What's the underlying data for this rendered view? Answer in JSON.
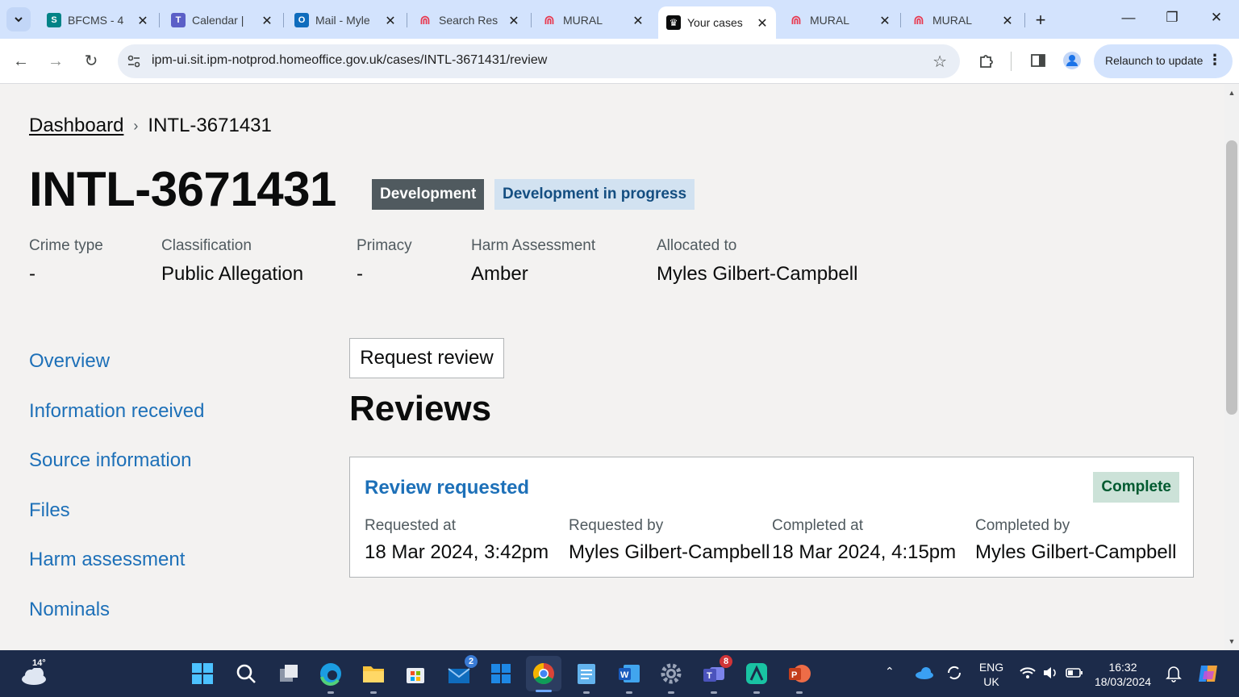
{
  "browser": {
    "tabs": [
      {
        "title": "BFCMS - 4",
        "icon": "sharepoint-icon",
        "color": "#038387",
        "active": false
      },
      {
        "title": "Calendar |",
        "icon": "teams-icon",
        "color": "#5b5fc7",
        "active": false
      },
      {
        "title": "Mail - Myle",
        "icon": "outlook-icon",
        "color": "#0f6cbd",
        "active": false
      },
      {
        "title": "Search Res",
        "icon": "mural-icon",
        "color": "#e8384f",
        "active": false
      },
      {
        "title": "MURAL",
        "icon": "mural-icon",
        "color": "#e8384f",
        "active": false
      },
      {
        "title": "Your cases",
        "icon": "crown-icon",
        "color": "#0b0c0c",
        "active": true
      },
      {
        "title": "MURAL",
        "icon": "mural-icon",
        "color": "#e8384f",
        "active": false
      },
      {
        "title": "MURAL",
        "icon": "mural-icon",
        "color": "#e8384f",
        "active": false
      }
    ],
    "url": "ipm-ui.sit.ipm-notprod.homeoffice.gov.uk/cases/INTL-3671431/review",
    "relaunch_label": "Relaunch to update"
  },
  "breadcrumb": {
    "home": "Dashboard",
    "current": "INTL-3671431"
  },
  "case": {
    "id": "INTL-3671431",
    "phase_tag": "Development",
    "status_tag": "Development in progress"
  },
  "summary": {
    "crime_type_label": "Crime type",
    "crime_type_value": "-",
    "classification_label": "Classification",
    "classification_value": "Public Allegation",
    "primacy_label": "Primacy",
    "primacy_value": "-",
    "harm_label": "Harm Assessment",
    "harm_value": "Amber",
    "allocated_label": "Allocated to",
    "allocated_value": "Myles Gilbert-Campbell"
  },
  "side_nav": [
    "Overview",
    "Information received",
    "Source information",
    "Files",
    "Harm assessment",
    "Nominals"
  ],
  "reviews": {
    "request_button": "Request review",
    "heading": "Reviews",
    "card": {
      "title": "Review requested",
      "status": "Complete",
      "requested_at_label": "Requested at",
      "requested_at_value": "18 Mar 2024, 3:42pm",
      "requested_by_label": "Requested by",
      "requested_by_value": "Myles Gilbert-Campbell",
      "completed_at_label": "Completed at",
      "completed_at_value": "18 Mar 2024, 4:15pm",
      "completed_by_label": "Completed by",
      "completed_by_value": "Myles Gilbert-Campbell"
    }
  },
  "taskbar": {
    "weather_temp": "14°",
    "mail_badge": "2",
    "teams_badge": "8",
    "lang_line1": "ENG",
    "lang_line2": "UK",
    "time": "16:32",
    "date": "18/03/2024"
  },
  "colors": {
    "link": "#1d70b8",
    "tag_grey": "#505a5f",
    "tag_blue_bg": "#d2e2f1",
    "tag_green_bg": "#cce2d8",
    "tag_green_text": "#005a30"
  }
}
